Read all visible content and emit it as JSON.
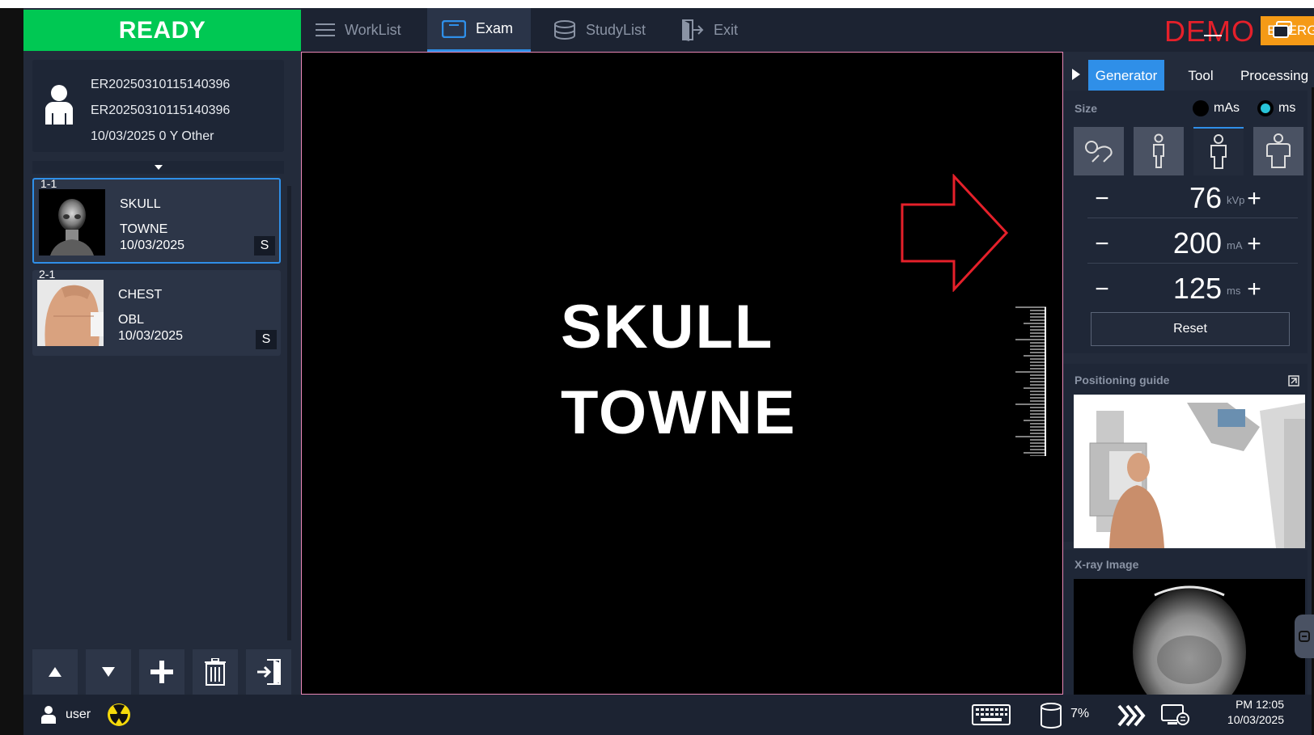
{
  "status": {
    "ready_label": "READY"
  },
  "nav": {
    "worklist": "WorkList",
    "exam": "Exam",
    "studylist": "StudyList",
    "exit": "Exit"
  },
  "banner": {
    "demo": "DEMO",
    "emergency": "EMERGENCY"
  },
  "patient": {
    "id": "ER20250310115140396",
    "accession": "ER20250310115140396",
    "info": "10/03/2025 0 Y Other"
  },
  "series": [
    {
      "num": "1-1",
      "body_part": "SKULL",
      "view": "TOWNE",
      "date": "10/03/2025",
      "badge": "S"
    },
    {
      "num": "2-1",
      "body_part": "CHEST",
      "view": "OBL",
      "date": "10/03/2025",
      "badge": "S"
    }
  ],
  "viewer": {
    "line1": "SKULL",
    "line2": "TOWNE"
  },
  "right_tabs": {
    "generator": "Generator",
    "tool": "Tool",
    "processing": "Processing"
  },
  "generator": {
    "size_label": "Size",
    "mode_mas": "mAs",
    "mode_ms": "ms",
    "selected_mode": "ms",
    "kvp": {
      "value": "76",
      "unit": "kVp"
    },
    "ma": {
      "value": "200",
      "unit": "mA"
    },
    "ms": {
      "value": "125",
      "unit": "ms"
    },
    "reset_label": "Reset"
  },
  "positioning": {
    "label": "Positioning guide"
  },
  "xray": {
    "label": "X-ray Image"
  },
  "statusbar": {
    "user": "user",
    "disk_usage": "7%",
    "time": "PM 12:05",
    "date": "10/03/2025"
  },
  "colors": {
    "ready": "#00c853",
    "accent": "#2f8fe8",
    "demo": "#e5202a",
    "emergency": "#f59a16",
    "viewer_border": "#e987b7",
    "annotation_arrow": "#e5202a"
  }
}
